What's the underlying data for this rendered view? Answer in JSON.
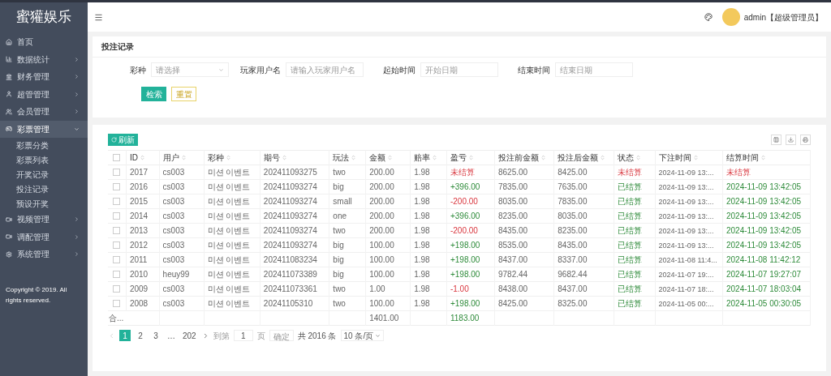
{
  "sidebar": {
    "logo": "蜜獾娱乐",
    "items": [
      {
        "label": "首页",
        "selected": false
      },
      {
        "label": "数据统计",
        "selected": false,
        "expanded": false
      },
      {
        "label": "财务管理",
        "selected": false,
        "expanded": false
      },
      {
        "label": "超管管理",
        "selected": false,
        "expanded": false
      },
      {
        "label": "会员管理",
        "selected": false,
        "expanded": false
      },
      {
        "label": "彩票管理",
        "selected": true,
        "expanded": true,
        "children": [
          {
            "label": "彩票分类"
          },
          {
            "label": "彩票列表"
          },
          {
            "label": "开奖记录"
          },
          {
            "label": "投注记录"
          },
          {
            "label": "预设开奖"
          }
        ]
      },
      {
        "label": "视频管理",
        "selected": false,
        "expanded": false
      },
      {
        "label": "调配管理",
        "selected": false,
        "expanded": false
      },
      {
        "label": "系统管理",
        "selected": false,
        "expanded": false
      }
    ],
    "copyright": "Copyright © 2019. All rights reserved."
  },
  "header": {
    "user": "admin【超级管理员】"
  },
  "search_card": {
    "title": "投注记录",
    "fields": [
      {
        "label": "彩种",
        "kind": "select",
        "placeholder": "请选择"
      },
      {
        "label": "玩家用户名",
        "kind": "text",
        "placeholder": "请输入玩家用户名"
      },
      {
        "label": "起始时间",
        "kind": "text",
        "placeholder": "开始日期"
      },
      {
        "label": "结束时间",
        "kind": "text",
        "placeholder": "结束日期"
      }
    ],
    "buttons": [
      {
        "label": "检索",
        "kind": "primary"
      },
      {
        "label": "重置",
        "kind": "outline"
      }
    ]
  },
  "table": {
    "refresh_button": "刷新",
    "all_checked": false,
    "columns": [
      "ID",
      "用户",
      "彩种",
      "期号",
      "玩法",
      "金额",
      "赔率",
      "盈亏",
      "投注前金额",
      "投注后金额",
      "状态",
      "下注时间",
      "结算时间"
    ],
    "rows": [
      {
        "cells": [
          "2017",
          "cs003",
          "미션 이벤트",
          "202411093275",
          "two",
          "200.00",
          "1.98",
          "未结算",
          "8625.00",
          "8425.00",
          "未结算",
          "2024-11-09 13:...",
          "未结算"
        ],
        "kind": "pending",
        "checked": false
      },
      {
        "cells": [
          "2016",
          "cs003",
          "미션 이벤트",
          "202411093274",
          "big",
          "200.00",
          "1.98",
          "+396.00",
          "7835.00",
          "7635.00",
          "已结算",
          "2024-11-09 13:...",
          "2024-11-09 13:42:05"
        ],
        "kind": "gain",
        "checked": false
      },
      {
        "cells": [
          "2015",
          "cs003",
          "미션 이벤트",
          "202411093274",
          "small",
          "200.00",
          "1.98",
          "-200.00",
          "8035.00",
          "7835.00",
          "已结算",
          "2024-11-09 13:...",
          "2024-11-09 13:42:05"
        ],
        "kind": "loss",
        "checked": false
      },
      {
        "cells": [
          "2014",
          "cs003",
          "미션 이벤트",
          "202411093274",
          "one",
          "200.00",
          "1.98",
          "+396.00",
          "8235.00",
          "8035.00",
          "已结算",
          "2024-11-09 13:...",
          "2024-11-09 13:42:05"
        ],
        "kind": "gain",
        "checked": false
      },
      {
        "cells": [
          "2013",
          "cs003",
          "미션 이벤트",
          "202411093274",
          "two",
          "200.00",
          "1.98",
          "-200.00",
          "8435.00",
          "8235.00",
          "已结算",
          "2024-11-09 13:...",
          "2024-11-09 13:42:05"
        ],
        "kind": "loss",
        "checked": false
      },
      {
        "cells": [
          "2012",
          "cs003",
          "미션 이벤트",
          "202411093274",
          "big",
          "100.00",
          "1.98",
          "+198.00",
          "8535.00",
          "8435.00",
          "已结算",
          "2024-11-09 13:...",
          "2024-11-09 13:42:05"
        ],
        "kind": "gain",
        "checked": false
      },
      {
        "cells": [
          "2011",
          "cs003",
          "미션 이벤트",
          "202411083234",
          "big",
          "100.00",
          "1.98",
          "+198.00",
          "8437.00",
          "8337.00",
          "已结算",
          "2024-11-08 11:4...",
          "2024-11-08 11:42:12"
        ],
        "kind": "gain",
        "checked": false
      },
      {
        "cells": [
          "2010",
          "heuy99",
          "미션 이벤트",
          "202411073389",
          "big",
          "100.00",
          "1.98",
          "+198.00",
          "9782.44",
          "9682.44",
          "已结算",
          "2024-11-07 19:...",
          "2024-11-07 19:27:07"
        ],
        "kind": "gain",
        "checked": false
      },
      {
        "cells": [
          "2009",
          "cs003",
          "미션 이벤트",
          "202411073361",
          "two",
          "1.00",
          "1.98",
          "-1.00",
          "8438.00",
          "8437.00",
          "已结算",
          "2024-11-07 18:...",
          "2024-11-07 18:03:04"
        ],
        "kind": "loss",
        "checked": false
      },
      {
        "cells": [
          "2008",
          "cs003",
          "미션 이벤트",
          "20241105310",
          "two",
          "100.00",
          "1.98",
          "+198.00",
          "8425.00",
          "8325.00",
          "已结算",
          "2024-11-05 00:...",
          "2024-11-05 00:30:05"
        ],
        "kind": "gain",
        "checked": false
      }
    ],
    "totals": {
      "label": "合...",
      "amount": "1401.00",
      "profit": "1183.00"
    }
  },
  "pager": {
    "pages": [
      {
        "label": "1",
        "selected": true
      },
      {
        "label": "2",
        "selected": false
      },
      {
        "label": "3",
        "selected": false
      },
      {
        "label": "…",
        "selected": false
      },
      {
        "label": "202",
        "selected": false
      }
    ],
    "goto_label": "到第",
    "goto_value": "1",
    "page_unit": "页",
    "confirm": "确定",
    "total": "共 2016 条",
    "page_size": "10 条/页"
  }
}
